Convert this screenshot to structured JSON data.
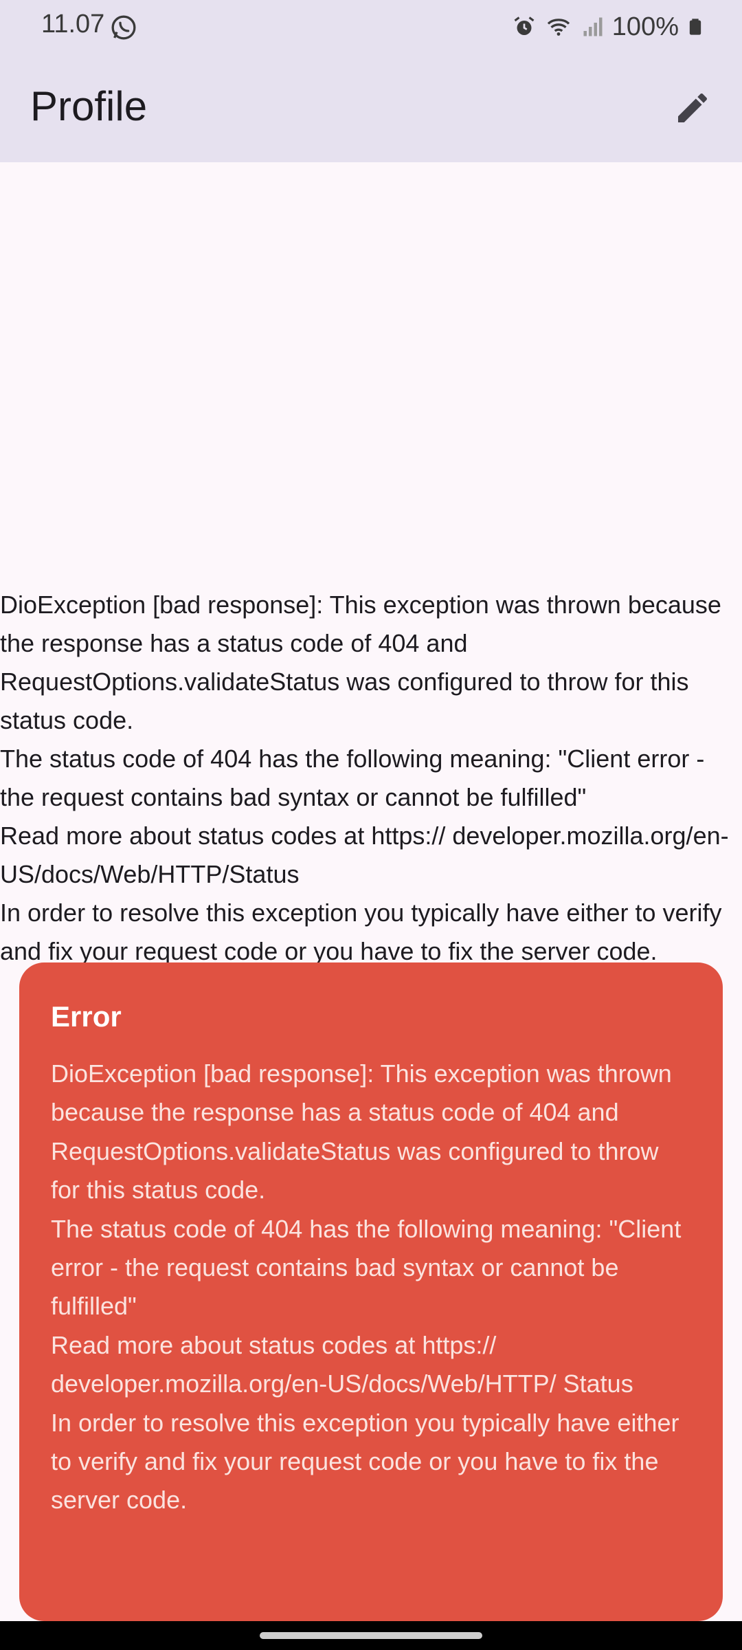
{
  "status_bar": {
    "time": "11.07",
    "battery": "100%",
    "icons": [
      "whatsapp-icon",
      "alarm-icon",
      "wifi-icon",
      "signal-icon",
      "battery-icon"
    ]
  },
  "app_bar": {
    "title": "Profile",
    "action_icon": "edit-icon"
  },
  "body": {
    "lines": [
      "DioException [bad response]: This exception was thrown because the response has a status code of 404 and RequestOptions.validateStatus was configured to throw for this status code.",
      "The status code of 404 has the following meaning: \"Client error - the request contains bad syntax or cannot be fulfilled\"",
      "Read more about status codes at https:// developer.mozilla.org/en-US/docs/Web/HTTP/Status",
      "In order to resolve this exception you typically have either to verify and fix your request code or you have to fix the server code."
    ]
  },
  "error_snackbar": {
    "title": "Error",
    "lines": [
      "DioException [bad response]: This exception was thrown because the response has a status code of 404 and RequestOptions.validateStatus was configured to throw for this status code.",
      "The status code of 404 has the following meaning: \"Client error - the request contains bad syntax or cannot be fulfilled\"",
      "Read more about status codes at https:// developer.mozilla.org/en-US/docs/Web/HTTP/ Status",
      "In order to resolve this exception you typically have either to verify and fix your request code or you have to fix the server code."
    ],
    "background": "#e05242"
  },
  "colors": {
    "app_bar": "#e6e1ef",
    "page_background": "#fdf7fb"
  }
}
